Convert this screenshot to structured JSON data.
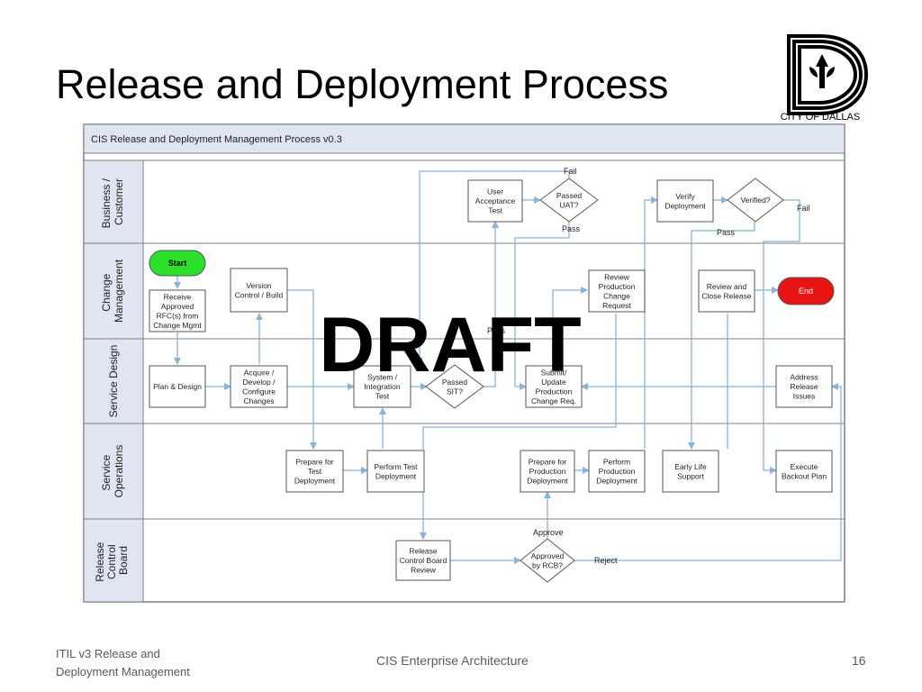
{
  "slide": {
    "title": "Release and Deployment Process",
    "logo_text": "CITY OF DALLAS"
  },
  "diagram": {
    "header": "CIS Release and Deployment Management Process v0.3",
    "watermark": "DRAFT",
    "lanes": [
      {
        "id": "business",
        "label": "Business /\nCustomer"
      },
      {
        "id": "change",
        "label": "Change\nManagement"
      },
      {
        "id": "service_design",
        "label": "Service Design"
      },
      {
        "id": "service_ops",
        "label": "Service\nOperations"
      },
      {
        "id": "rcb",
        "label": "Release\nControl\nBoard"
      }
    ],
    "nodes": {
      "start": "Start",
      "end": "End",
      "receive_rfc": "Receive\nApproved\nRFC(s) from\nChange Mgmt",
      "version_control": "Version\nControl / Build",
      "plan_design": "Plan & Design",
      "acquire": "Acquire /\nDevelop /\nConfigure\nChanges",
      "prepare_test": "Prepare for\nTest\nDeployment",
      "perform_test": "Perform Test\nDeployment",
      "sit": "System /\nIntegration\nTest",
      "passed_sit": "Passed\nSIT?",
      "uat": "User\nAcceptance\nTest",
      "passed_uat": "Passed\nUAT?",
      "review_prod_change": "Review\nProduction\nChange\nRequest",
      "submit_update": "Submit/\nUpdate\nProduction\nChange Req.",
      "prepare_prod": "Prepare for\nProduction\nDeployment",
      "perform_prod": "Perform\nProduction\nDeployment",
      "rcb_review": "Release\nControl Board\nReview",
      "approved_rcb": "Approved\nby RCB?",
      "verify_deploy": "Verify\nDeployment",
      "verified": "Verified?",
      "review_close": "Review and\nClose Release",
      "early_life": "Early Life\nSupport",
      "address_issues": "Address\nRelease\nIssues",
      "execute_backout": "Execute\nBackout Plan"
    },
    "edge_labels": {
      "fail_uat": "Fail",
      "pass_uat": "Pass",
      "pass_sit": "Pass",
      "pass_verify": "Pass",
      "fail_verify": "Fail",
      "approve": "Approve",
      "reject": "Reject"
    }
  },
  "footer": {
    "left": "ITIL v3 Release and\nDeployment Management",
    "center": "CIS Enterprise Architecture",
    "page": "16"
  },
  "colors": {
    "lane_fill": "#dfe6f1",
    "line": "#8bb2d9",
    "start": "#2ce02c",
    "end": "#e81313"
  }
}
